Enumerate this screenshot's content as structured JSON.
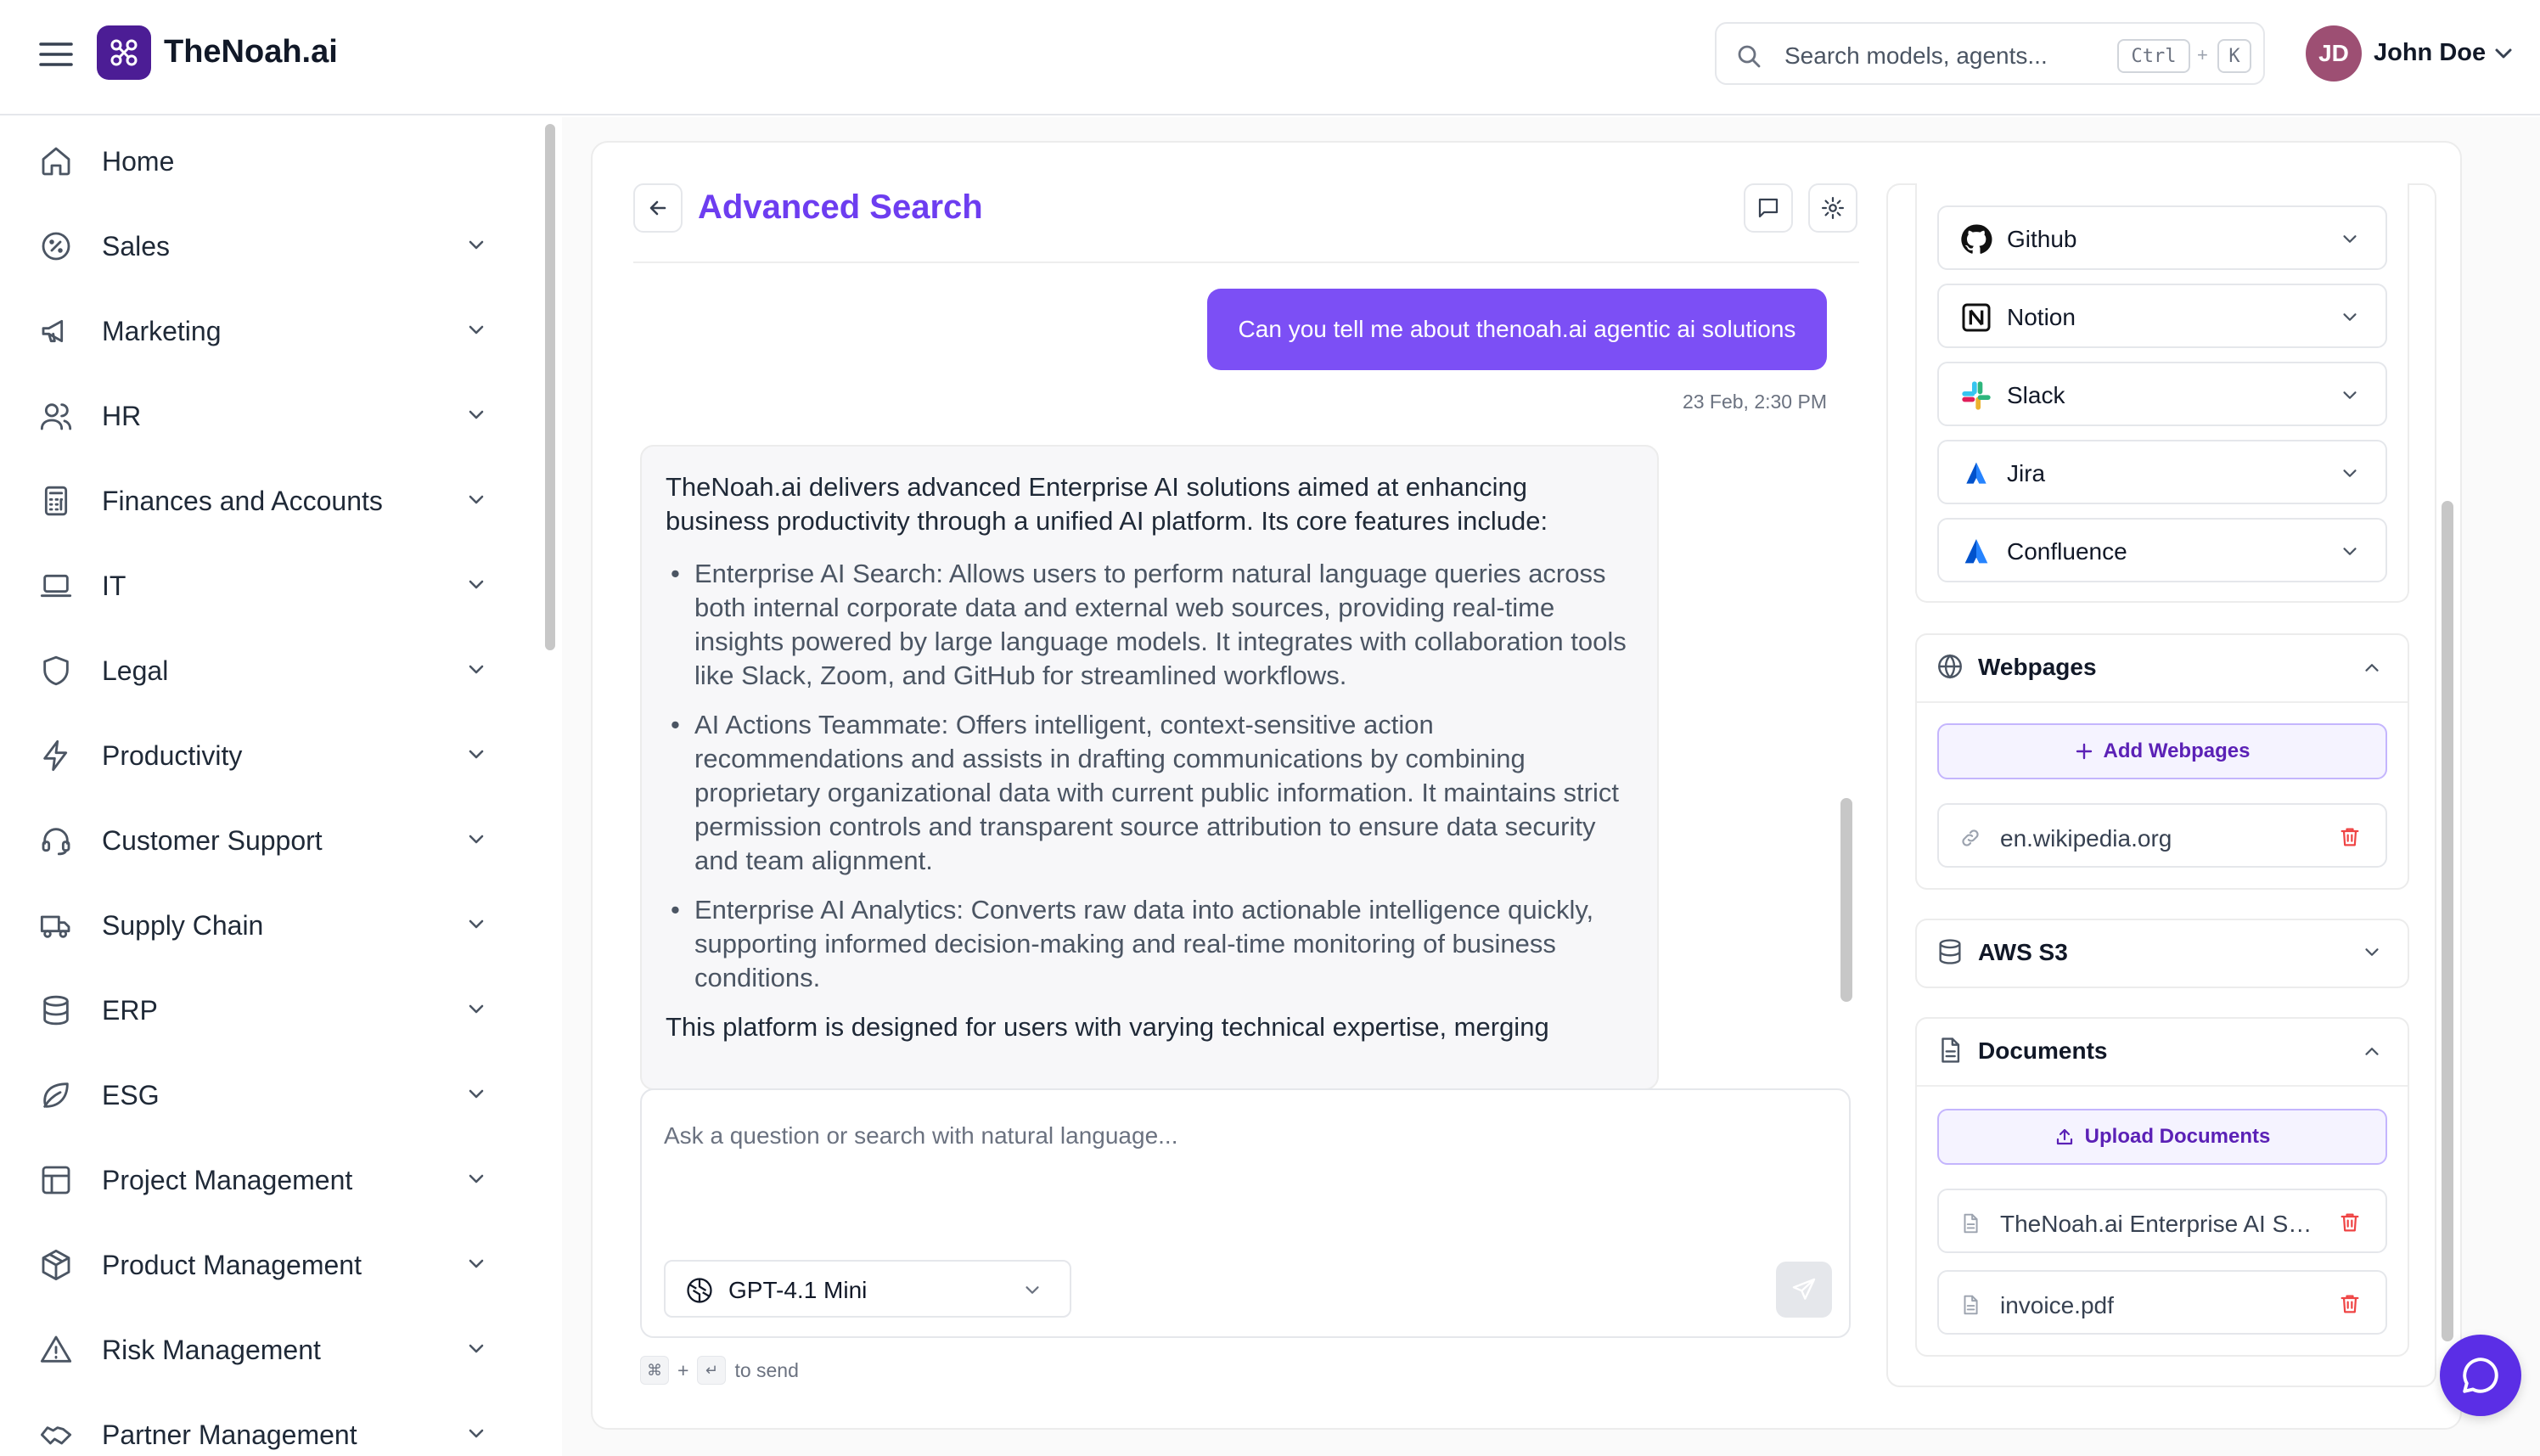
{
  "header": {
    "brand": "TheNoah.ai",
    "search_placeholder": "Search models, agents...",
    "kbd_ctrl": "Ctrl",
    "kbd_plus": "+",
    "kbd_k": "K",
    "avatar_initials": "JD",
    "user_name": "John Doe"
  },
  "sidebar": {
    "items": [
      {
        "label": "Home",
        "icon": "home-icon"
      },
      {
        "label": "Sales",
        "icon": "badge-percent-icon"
      },
      {
        "label": "Marketing",
        "icon": "megaphone-icon"
      },
      {
        "label": "HR",
        "icon": "users-icon"
      },
      {
        "label": "Finances and Accounts",
        "icon": "calculator-icon"
      },
      {
        "label": "IT",
        "icon": "laptop-icon"
      },
      {
        "label": "Legal",
        "icon": "shield-icon"
      },
      {
        "label": "Productivity",
        "icon": "lightning-icon"
      },
      {
        "label": "Customer Support",
        "icon": "headset-icon"
      },
      {
        "label": "Supply Chain",
        "icon": "truck-icon"
      },
      {
        "label": "ERP",
        "icon": "database-icon"
      },
      {
        "label": "ESG",
        "icon": "leaf-icon"
      },
      {
        "label": "Project Management",
        "icon": "layout-icon"
      },
      {
        "label": "Product Management",
        "icon": "package-icon"
      },
      {
        "label": "Risk Management",
        "icon": "warning-icon"
      },
      {
        "label": "Partner Management",
        "icon": "handshake-icon"
      }
    ]
  },
  "chat": {
    "title": "Advanced Search",
    "user_message": "Can you tell me about thenoah.ai agentic ai solutions",
    "timestamp": "23 Feb, 2:30 PM",
    "ai_intro": "TheNoah.ai delivers advanced Enterprise AI solutions aimed at enhancing business productivity through a unified AI platform. Its core features include:",
    "ai_bullets": [
      "Enterprise AI Search: Allows users to perform natural language queries across both internal corporate data and external web sources, providing real-time insights powered by large language models. It integrates with collaboration tools like Slack, Zoom, and GitHub for streamlined workflows.",
      "AI Actions Teammate: Offers intelligent, context-sensitive action recommendations and assists in drafting communications by combining proprietary organizational data with current public information. It maintains strict permission controls and transparent source attribution to ensure data security and team alignment.",
      "Enterprise AI Analytics: Converts raw data into actionable intelligence quickly, supporting informed decision-making and real-time monitoring of business conditions."
    ],
    "ai_outro": "This platform is designed for users with varying technical expertise, merging",
    "composer_placeholder": "Ask a question or search with natural language...",
    "model": "GPT-4.1 Mini",
    "hint_cmd": "⌘",
    "hint_plus": "+",
    "hint_enter": "↵",
    "hint_text": "to send"
  },
  "sources": {
    "integrations": [
      {
        "label": "Github",
        "icon": "github-icon"
      },
      {
        "label": "Notion",
        "icon": "notion-icon"
      },
      {
        "label": "Slack",
        "icon": "slack-icon"
      },
      {
        "label": "Jira",
        "icon": "jira-icon"
      },
      {
        "label": "Confluence",
        "icon": "confluence-icon"
      }
    ],
    "webpages_title": "Webpages",
    "add_webpages": "Add Webpages",
    "webpages": [
      "en.wikipedia.org"
    ],
    "aws_title": "AWS S3",
    "documents_title": "Documents",
    "upload_documents": "Upload Documents",
    "documents": [
      "TheNoah.ai Enterprise AI Solutions.pdf",
      "invoice.pdf"
    ]
  },
  "colors": {
    "accent": "#6d3df0",
    "bubble": "#7c4ff5",
    "brand_logo": "#4c1d95",
    "danger": "#ef4444"
  }
}
